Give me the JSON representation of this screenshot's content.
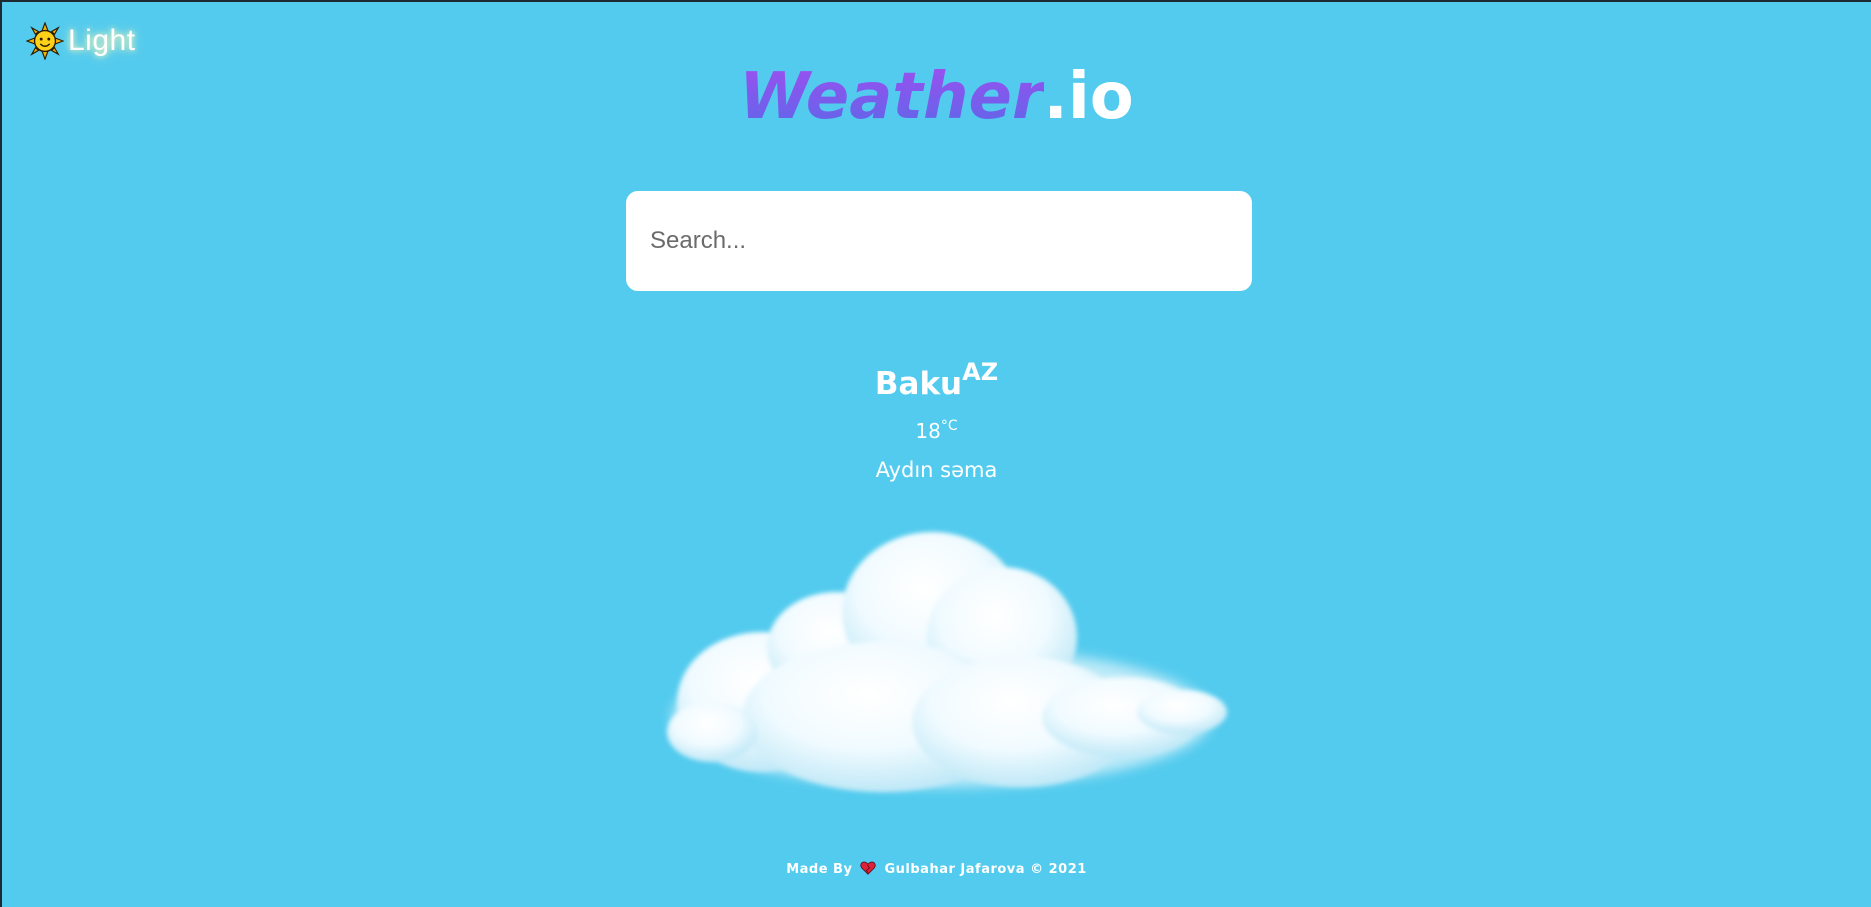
{
  "theme_toggle": {
    "icon": "sun-icon",
    "label": "Light"
  },
  "logo": {
    "main": "Weather",
    "suffix": ".io"
  },
  "search": {
    "placeholder": "Search...",
    "value": ""
  },
  "weather": {
    "city": "Baku",
    "country": "AZ",
    "temperature": "18",
    "unit": "°C",
    "description": "Aydın səma",
    "icon": "cloud-icon"
  },
  "footer": {
    "made_by": "Made By",
    "heart_icon": "heart-icon",
    "author": "Gulbahar Jafarova © 2021"
  },
  "colors": {
    "background": "#53cbee",
    "logo_gradient_start": "#a04ef0",
    "logo_gradient_end": "#5a68e8",
    "text": "#ffffff"
  }
}
